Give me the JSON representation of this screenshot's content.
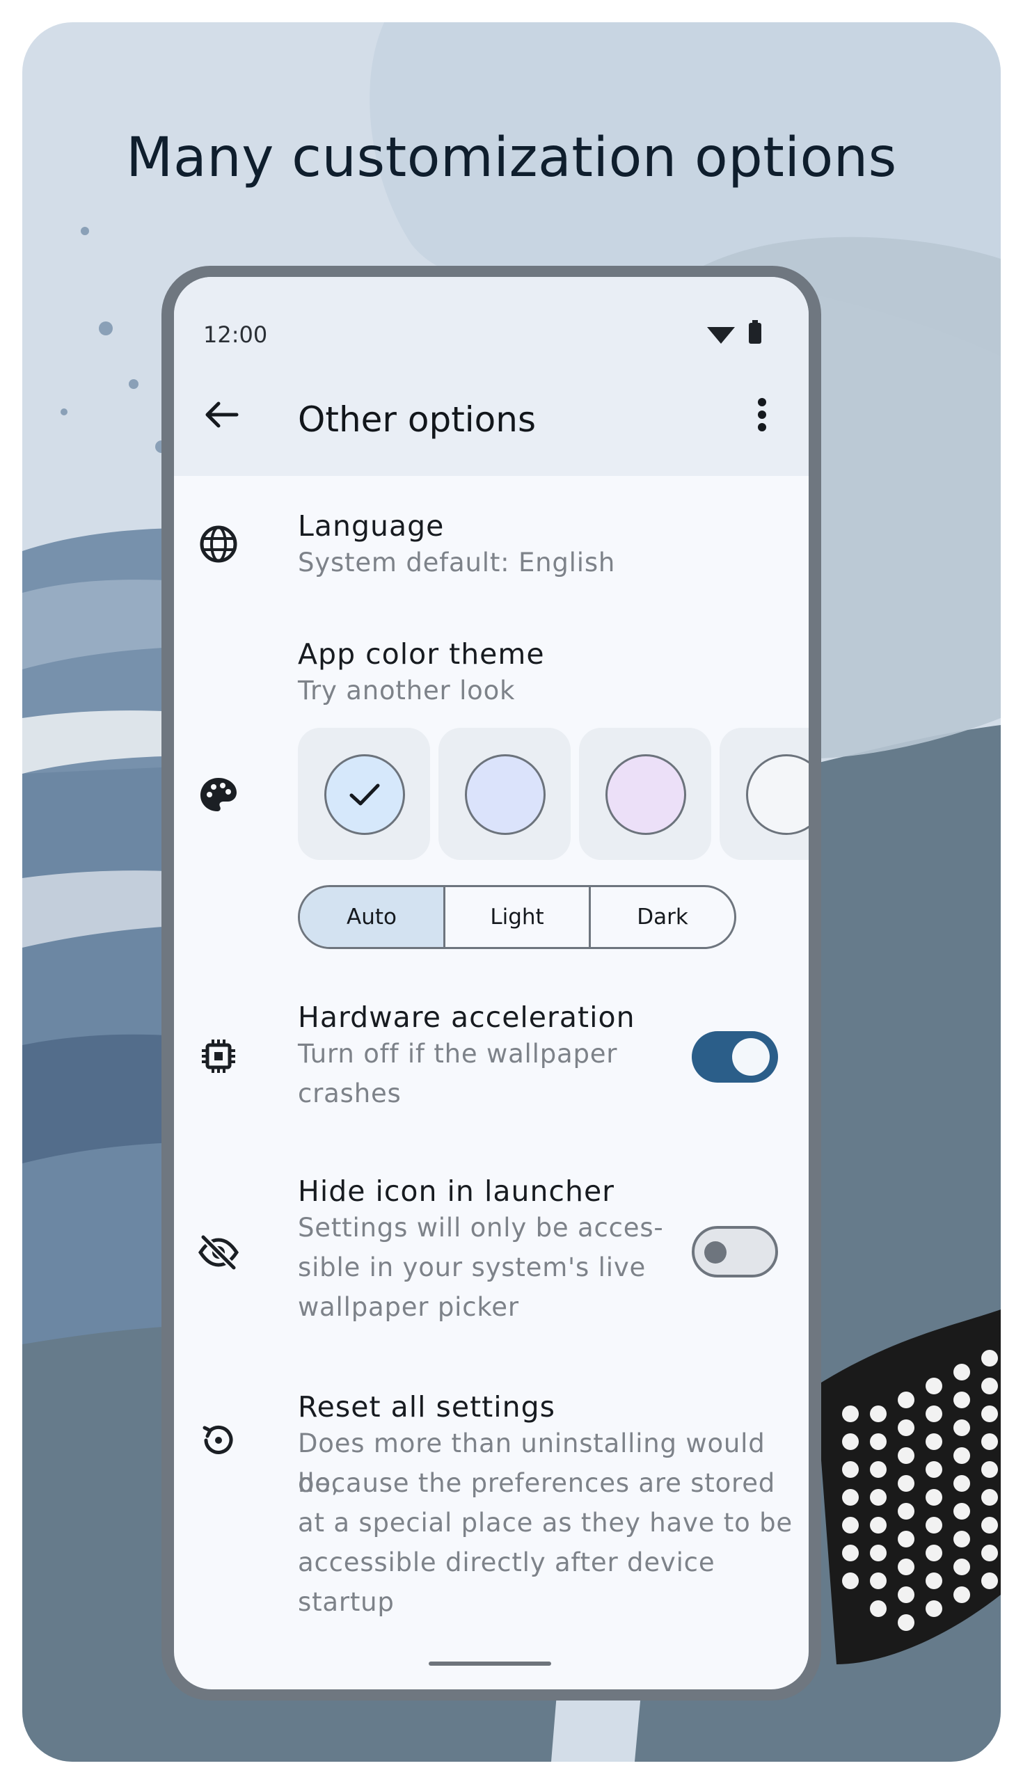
{
  "headline": "Many customization options",
  "status_bar": {
    "time": "12:00",
    "icons": [
      "wifi-icon",
      "battery-icon"
    ]
  },
  "app_bar": {
    "title": "Other options",
    "back_icon": "arrow-back-icon",
    "menu_icon": "more-vert-icon"
  },
  "settings": {
    "language": {
      "title": "Language",
      "subtitle": "System default: English",
      "icon": "globe-icon"
    },
    "theme": {
      "title": "App color theme",
      "subtitle": "Try another look",
      "icon": "palette-icon",
      "swatches": [
        {
          "color": "#d6e8fb",
          "selected": true
        },
        {
          "color": "#dbe3fb",
          "selected": false
        },
        {
          "color": "#ece0f8",
          "selected": false
        },
        {
          "color": "#f4f6f9",
          "selected": false
        }
      ],
      "modes": [
        "Auto",
        "Light",
        "Dark"
      ],
      "selected_mode": "Auto"
    },
    "hardware": {
      "title": "Hardware acceleration",
      "subtitle_lines": [
        "Turn off if the wallpaper",
        "crashes"
      ],
      "icon": "chip-icon",
      "enabled": true
    },
    "hide_icon": {
      "title": "Hide icon in launcher",
      "subtitle_lines": [
        "Settings will only be acces-",
        "sible in your system's live",
        "wallpaper picker"
      ],
      "icon": "visibility-off-icon",
      "enabled": false
    },
    "reset": {
      "title": "Reset all settings",
      "subtitle_lines": [
        "Does more than uninstalling would do,",
        "because the preferences are stored",
        "at a special place as they have to be",
        "accessible directly after device startup"
      ],
      "icon": "reset-icon"
    }
  },
  "colors": {
    "toggle_on": "#2b5e89",
    "toggle_off_track": "#e2e5ea",
    "accent_selected": "#d3e2f1",
    "background_slate": "#667b8b"
  }
}
